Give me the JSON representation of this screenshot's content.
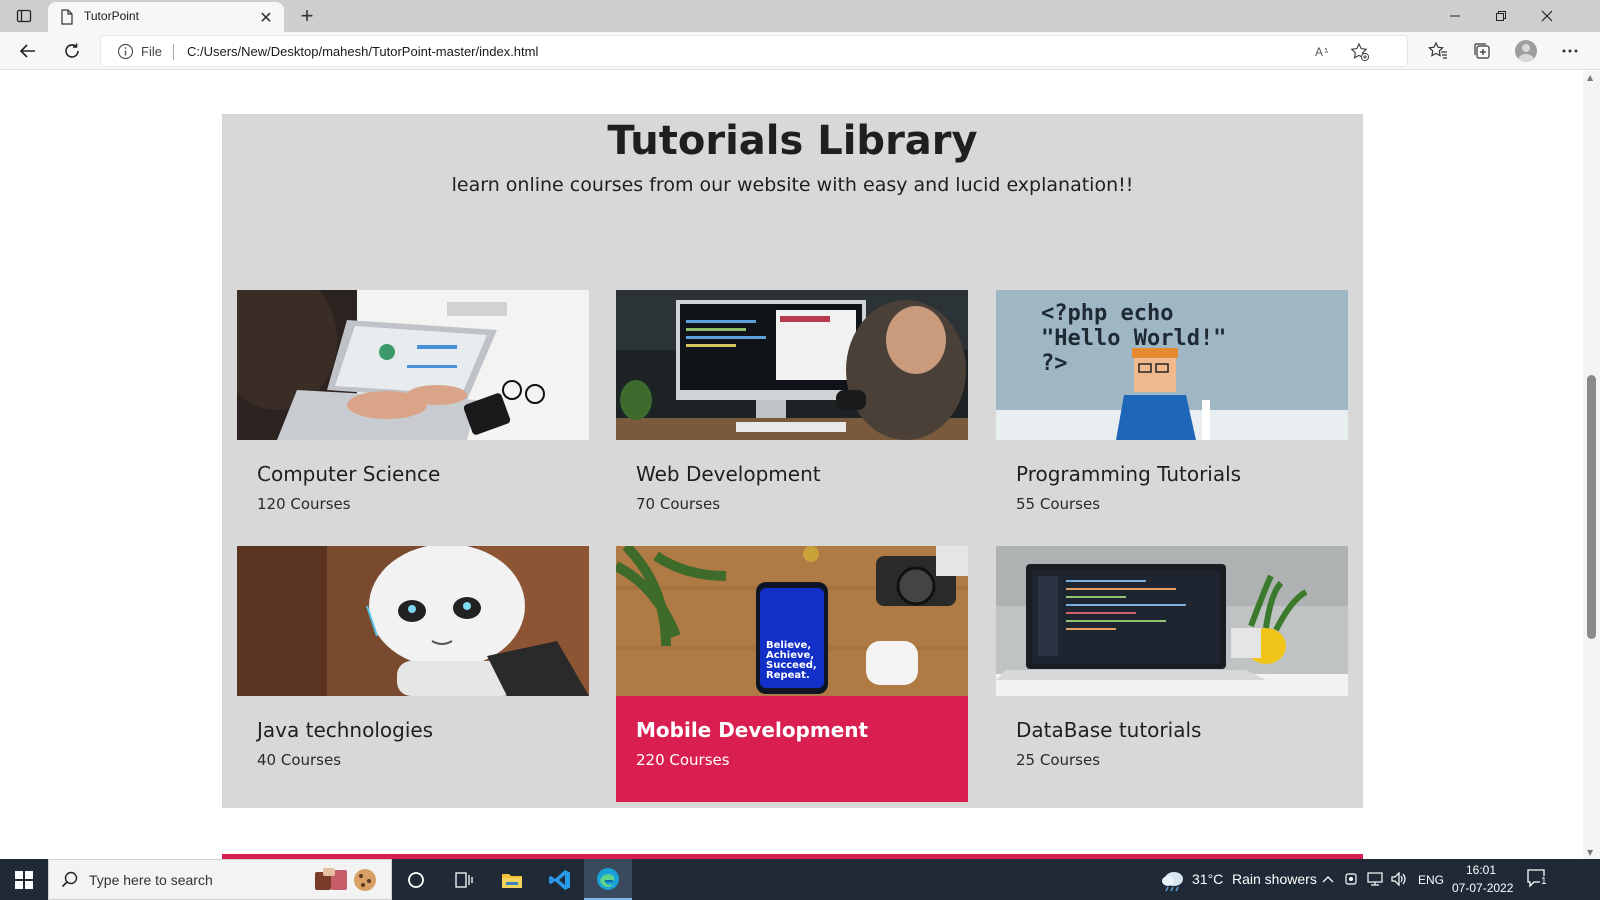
{
  "browser": {
    "tab_title": "TutorPoint",
    "address_scheme": "File",
    "address_url": "C:/Users/New/Desktop/mahesh/TutorPoint-master/index.html"
  },
  "library": {
    "title": "Tutorials Library",
    "subtitle": "learn online courses from our website with easy and lucid explanation!!",
    "cards": [
      {
        "title": "Computer Science",
        "count": "120 Courses",
        "image": "laptop-analytics-photo"
      },
      {
        "title": "Web Development",
        "count": "70 Courses",
        "image": "developer-desktop-photo"
      },
      {
        "title": "Programming Tutorials",
        "count": "55 Courses",
        "image": "php-hello-world-photo",
        "image_text": [
          "<?php echo",
          "\"Hello World!\"",
          "?>"
        ]
      },
      {
        "title": "Java technologies",
        "count": "40 Courses",
        "image": "robot-photo"
      },
      {
        "title": "Mobile Development",
        "count": "220 Courses",
        "image": "phone-on-desk-photo",
        "image_text": [
          "Believe,",
          "Achieve,",
          "Succeed,",
          "Repeat."
        ],
        "active": true
      },
      {
        "title": "DataBase tutorials",
        "count": "25 Courses",
        "image": "laptop-code-photo"
      }
    ]
  },
  "taskbar": {
    "search_placeholder": "Type here to search",
    "weather_temp": "31°C",
    "weather_text": "Rain showers",
    "language": "ENG",
    "time": "16:01",
    "date": "07-07-2022",
    "notification_count": "1"
  },
  "colors": {
    "accent": "#d91f4f",
    "panel_bg": "#d8d8d8",
    "taskbar_bg": "#1f2a36"
  }
}
